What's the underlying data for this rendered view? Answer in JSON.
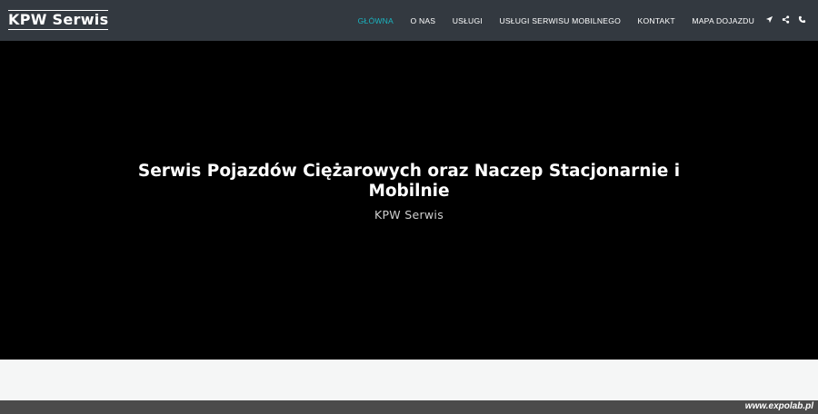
{
  "header": {
    "logo": "KPW Serwis",
    "nav": [
      {
        "label": "Główna",
        "active": true
      },
      {
        "label": "O nas",
        "active": false
      },
      {
        "label": "Usługi",
        "active": false
      },
      {
        "label": "Usługi serwisu mobilnego",
        "active": false
      },
      {
        "label": "Kontakt",
        "active": false
      },
      {
        "label": "Mapa dojazdu",
        "active": false
      }
    ],
    "icons": [
      "location-arrow-icon",
      "share-icon",
      "phone-icon"
    ],
    "active_color": "#1ab5c1",
    "background": "#333940"
  },
  "hero": {
    "title": "Serwis Pojazdów Ciężarowych oraz Naczep Stacjonarnie i Mobilnie",
    "subtitle": "KPW Serwis",
    "background": "#000000"
  },
  "footer": {
    "watermark": "www.expolab.pl"
  }
}
